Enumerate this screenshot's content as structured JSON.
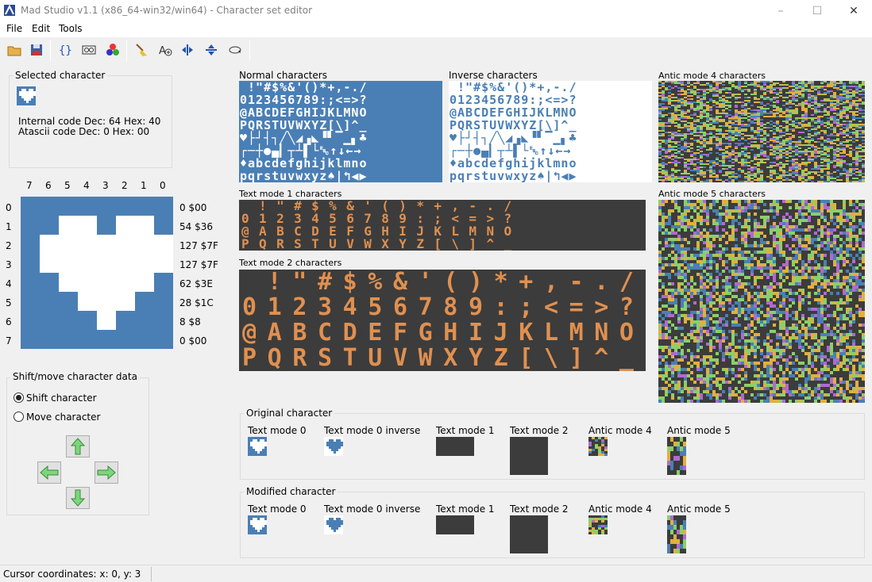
{
  "window": {
    "title": "Mad Studio  v1.1 (x86_64-win32/win64) - Character set editor"
  },
  "menu": [
    "File",
    "Edit",
    "Tools"
  ],
  "toolbar": {
    "buttons": [
      "open-icon",
      "save-icon",
      "code-braces-icon",
      "view-icon",
      "palette-icon",
      "clear-broom-icon",
      "add-char-icon",
      "flip-horizontal-icon",
      "flip-vertical-icon",
      "rotate-icon"
    ]
  },
  "selected": {
    "group_title": "Selected character",
    "internal_code": "Internal code Dec: 64 Hex: 40",
    "atascii_code": "Atascii code Dec: 0 Hex: 00"
  },
  "grid": {
    "col_headers": [
      "7",
      "6",
      "5",
      "4",
      "3",
      "2",
      "1",
      "0"
    ],
    "row_headers": [
      "0",
      "1",
      "2",
      "3",
      "4",
      "5",
      "6",
      "7"
    ],
    "row_values": [
      "0 $00",
      "54 $36",
      "127 $7F",
      "127 $7F",
      "62 $3E",
      "28 $1C",
      "8 $8",
      "0 $00"
    ],
    "rows": [
      0,
      54,
      127,
      127,
      62,
      28,
      8,
      0
    ]
  },
  "shift": {
    "group_title": "Shift/move character data",
    "option_shift": "Shift character",
    "option_move": "Move character",
    "selected": "shift"
  },
  "charsets": {
    "normal_title": "Normal characters",
    "inverse_title": "Inverse characters",
    "antic4_title": "Antic mode 4 characters",
    "mode1_title": "Text mode 1 characters",
    "mode2_title": "Text mode 2 characters",
    "antic5_title": "Antic mode 5 characters",
    "normal_lines": [
      " !\"#$%&'()*+,-./",
      "0123456789:;<=>?",
      "@ABCDEFGHIJKLMNO",
      "PQRSTUVWXYZ[\\]^_",
      "♥├┘┤┐╱╲◢▗◣▝▘▔▁▖♣",
      "┌─┼●▄▎┬┴▌└␛↑↓←→ ",
      "♦abcdefghijklmno",
      "pqrstuvwxyz♠|↰◀▶"
    ],
    "mode1_lines": [
      " !\"#$%&'()*+,-./",
      "0123456789:;<=>?",
      "@ABCDEFGHIJKLMNO",
      "PQRSTUVWXYZ[\\]^_"
    ],
    "mode2_lines": [
      " !\"#$%&'()*+,-./",
      "0123456789:;<=>?",
      "@ABCDEFGHIJKLMNO",
      "PQRSTUVWXYZ[\\]^_"
    ]
  },
  "original": {
    "group_title": "Original character",
    "labels": [
      "Text mode 0",
      "Text mode 0 inverse",
      "Text mode 1",
      "Text mode 2",
      "Antic mode 4",
      "Antic mode 5"
    ]
  },
  "modified": {
    "group_title": "Modified character",
    "labels": [
      "Text mode 0",
      "Text mode 0 inverse",
      "Text mode 1",
      "Text mode 2",
      "Antic mode 4",
      "Antic mode 5"
    ]
  },
  "status": {
    "cursor": "Cursor coordinates: x: 0, y: 3"
  },
  "colors": {
    "blue": "#4a7fb5",
    "white": "#ffffff",
    "dark": "#3c3c3c",
    "orange": "#e09050",
    "green_arrow": "#7cd67c"
  }
}
